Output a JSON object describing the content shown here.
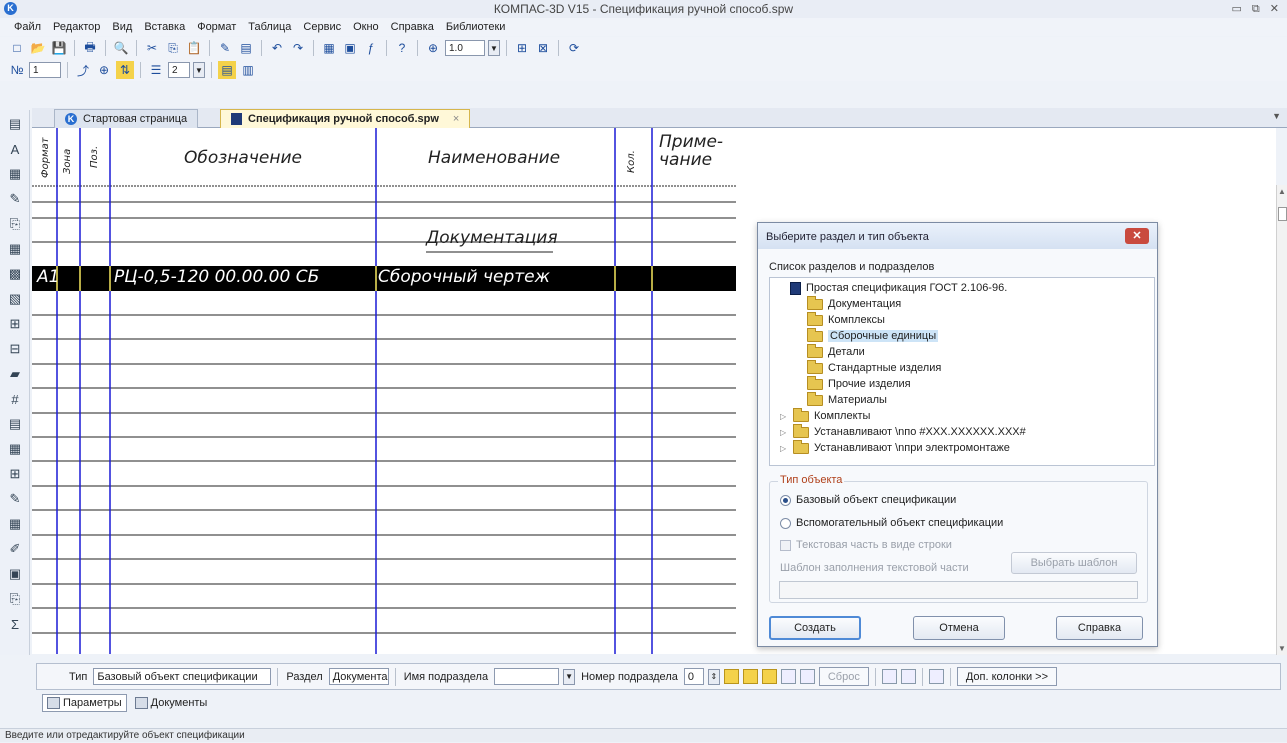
{
  "window": {
    "title": "КОМПАС-3D V15 - Спецификация ручной способ.spw",
    "app_icon": "kompas-logo-icon",
    "controls": [
      "minimize-icon",
      "restore-icon",
      "close-icon"
    ]
  },
  "menu": [
    {
      "label": "Файл",
      "u": "Ф"
    },
    {
      "label": "Редактор",
      "u": "Р"
    },
    {
      "label": "Вид",
      "u": "В"
    },
    {
      "label": "Вставка",
      "u": "а"
    },
    {
      "label": "Формат",
      "u": "м"
    },
    {
      "label": "Таблица",
      "u": "Т"
    },
    {
      "label": "Сервис",
      "u": "е"
    },
    {
      "label": "Окно",
      "u": "О"
    },
    {
      "label": "Справка",
      "u": "С"
    },
    {
      "label": "Библиотеки",
      "u": "Б"
    }
  ],
  "toolbar1": {
    "zoom_value": "1.0"
  },
  "toolbar2": {
    "page_value": "1",
    "lines_value": "2"
  },
  "tabs": [
    {
      "label": "Стартовая страница"
    },
    {
      "label": "Спецификация ручной способ.spw",
      "close": "×"
    }
  ],
  "spec": {
    "headers": {
      "format": "Формат",
      "zone": "Зона",
      "pos": "Поз.",
      "designation": "Обозначение",
      "name": "Наименование",
      "qty": "Кол.",
      "note_line1": "Приме-",
      "note_line2": "чание"
    },
    "section_title": "Документация",
    "selected_row": {
      "format": "А1",
      "designation": "РЦ-0,5-120 00.00.00 СБ",
      "name": "Сборочный чертеж"
    }
  },
  "dialog": {
    "title": "Выберите раздел и тип объекта",
    "list_label": "Список разделов и подразделов",
    "tree_root": "Простая спецификация ГОСТ 2.106-96.",
    "tree_items": [
      {
        "label": "Документация",
        "expandable": false,
        "selected": false
      },
      {
        "label": "Комплексы",
        "expandable": false,
        "selected": false
      },
      {
        "label": "Сборочные единицы",
        "expandable": false,
        "selected": true
      },
      {
        "label": "Детали",
        "expandable": false,
        "selected": false
      },
      {
        "label": "Стандартные изделия",
        "expandable": false,
        "selected": false
      },
      {
        "label": "Прочие изделия",
        "expandable": false,
        "selected": false
      },
      {
        "label": "Материалы",
        "expandable": false,
        "selected": false
      },
      {
        "label": "Комплекты",
        "expandable": true,
        "selected": false
      },
      {
        "label": "Устанавливают \\nпо #XXX.XXXXXX.XXX#",
        "expandable": true,
        "selected": false
      },
      {
        "label": "Устанавливают \\nпри электромонтаже",
        "expandable": true,
        "selected": false
      }
    ],
    "object_type_label": "Тип объекта",
    "radio_base": "Базовый объект спецификации",
    "radio_aux": "Вспомогательный объект спецификации",
    "radio_selected": "base",
    "text_as_row": "Текстовая часть в виде строки",
    "template_label": "Шаблон заполнения текстовой части",
    "choose_template": "Выбрать шаблон",
    "create": "Создать",
    "cancel": "Отмена",
    "help": "Справка"
  },
  "props": {
    "type_label": "Тип",
    "type_value": "Базовый объект спецификации",
    "section_label": "Раздел",
    "section_value": "Документа",
    "subsection_name_label": "Имя подраздела",
    "subsection_name_value": "",
    "subsection_num_label": "Номер подраздела",
    "subsection_num_value": "0",
    "reset": "Сброс",
    "extra_cols": "Доп. колонки  >>"
  },
  "panel_tabs": [
    {
      "label": "Параметры",
      "active": true
    },
    {
      "label": "Документы",
      "active": false
    }
  ],
  "status": "Введите или отредактируйте объект спецификации"
}
